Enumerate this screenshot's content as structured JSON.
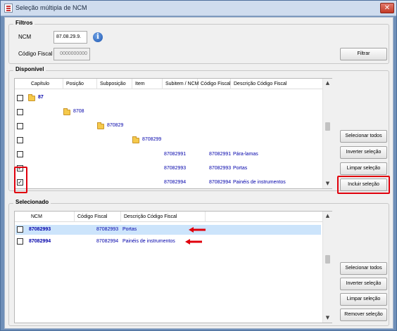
{
  "window": {
    "title": "Seleção múltipla de NCM",
    "close_icon": "close-icon"
  },
  "filtros": {
    "title": "Filtros",
    "ncm_label": "NCM",
    "ncm_value": "87.08.29.9.",
    "codigo_fiscal_label": "Código Fiscal",
    "codigo_fiscal_value": "0000000000",
    "filtrar_label": "Filtrar"
  },
  "disponivel": {
    "title": "Disponível",
    "columns": [
      "Capítulo",
      "Posição",
      "Subposição",
      "Item",
      "Subitem / NCM",
      "Código Fiscal",
      "Descrição Código Fiscal"
    ],
    "rows": [
      {
        "checked": false,
        "capitulo": "87",
        "posicao": "",
        "subposicao": "",
        "item": "",
        "subitem": "",
        "codigo": "",
        "descricao": ""
      },
      {
        "checked": false,
        "capitulo": "",
        "posicao": "8708",
        "subposicao": "",
        "item": "",
        "subitem": "",
        "codigo": "",
        "descricao": ""
      },
      {
        "checked": false,
        "capitulo": "",
        "posicao": "",
        "subposicao": "870829",
        "item": "",
        "subitem": "",
        "codigo": "",
        "descricao": ""
      },
      {
        "checked": false,
        "capitulo": "",
        "posicao": "",
        "subposicao": "",
        "item": "8708299",
        "subitem": "",
        "codigo": "",
        "descricao": ""
      },
      {
        "checked": false,
        "capitulo": "",
        "posicao": "",
        "subposicao": "",
        "item": "",
        "subitem": "87082991",
        "codigo": "87082991",
        "descricao": "Pára-lamas"
      },
      {
        "checked": true,
        "capitulo": "",
        "posicao": "",
        "subposicao": "",
        "item": "",
        "subitem": "87082993",
        "codigo": "87082993",
        "descricao": "Portas"
      },
      {
        "checked": true,
        "capitulo": "",
        "posicao": "",
        "subposicao": "",
        "item": "",
        "subitem": "87082994",
        "codigo": "87082994",
        "descricao": "Painéis de instrumentos"
      }
    ],
    "buttons": {
      "selecionar_todos": "Selecionar todos",
      "inverter_selecao": "Inverter seleção",
      "limpar_selecao": "Limpar seleção",
      "incluir_selecao": "Incluir seleção"
    }
  },
  "selecionado": {
    "title": "Selecionado",
    "columns": [
      "NCM",
      "Código Fiscal",
      "Descrição Código Fiscal"
    ],
    "rows": [
      {
        "checked": false,
        "ncm": "87082993",
        "codigo": "87082993",
        "descricao": "Portas",
        "selected": true
      },
      {
        "checked": false,
        "ncm": "87082994",
        "codigo": "87082994",
        "descricao": "Painéis de instrumentos",
        "selected": false
      }
    ],
    "buttons": {
      "selecionar_todos": "Selecionar todos",
      "inverter_selecao": "Inverter seleção",
      "limpar_selecao": "Limpar seleção",
      "remover_selecao": "Remover seleção"
    }
  },
  "colors": {
    "highlight_red": "#e0000c",
    "selected_row": "#cce4fb",
    "folder": "#f5c94b",
    "link_blue": "#0000aa"
  },
  "icons": {
    "info": "info-icon",
    "folder": "folder-icon",
    "checkbox": "checkbox-icon",
    "arrow": "red-arrow-icon"
  }
}
